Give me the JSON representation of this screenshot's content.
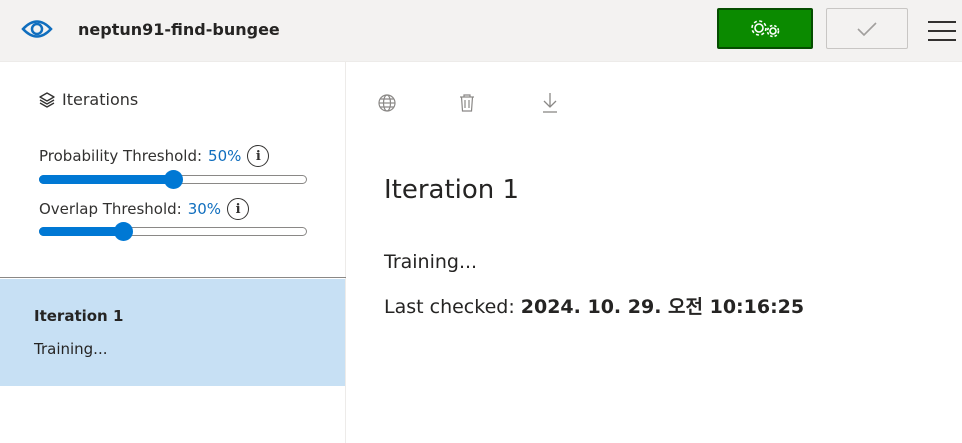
{
  "header": {
    "project_name": "neptun91-find-bungee",
    "train_button_icon": "gears-icon",
    "quick_test_icon": "checkmark-icon",
    "menu_icon": "hamburger-icon",
    "accent_color": "#0b8a00"
  },
  "sidebar": {
    "iterations_label": "Iterations",
    "probability": {
      "label": "Probability Threshold:",
      "value_text": "50%",
      "value": 50
    },
    "overlap": {
      "label": "Overlap Threshold:",
      "value_text": "30%",
      "value": 30
    },
    "iterations": [
      {
        "name": "Iteration 1",
        "status": "Training..."
      }
    ]
  },
  "main": {
    "toolbar_icons": [
      "globe-icon",
      "trash-icon",
      "download-icon"
    ],
    "title": "Iteration 1",
    "status": "Training...",
    "last_checked_label": "Last checked:",
    "last_checked_value": "2024. 10. 29. 오전 10:16:25"
  }
}
